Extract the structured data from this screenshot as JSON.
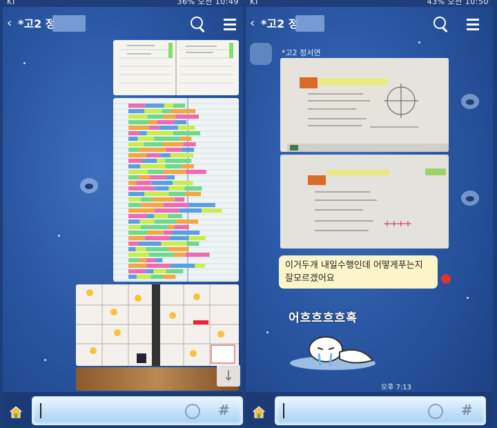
{
  "left": {
    "status": {
      "carrier": "KT",
      "info": "36% 오전 10:49"
    },
    "header": {
      "back": "‹",
      "title": "*고2 정"
    },
    "scroll_down": "↓"
  },
  "right": {
    "status": {
      "carrier": "KT",
      "info": "43% 오전 10:50"
    },
    "header": {
      "back": "‹",
      "title": "*고2 정"
    },
    "sender": "*고2 정서연",
    "message": "이거두개 내일수행인데 어떻게푸는지 잘모르겠어요",
    "sticker_text": "어흐흐흐흐흑",
    "time": "오후 7:13"
  },
  "icons": {
    "back": "back-icon",
    "search": "search-icon",
    "menu": "menu-icon",
    "emoji": "emoji-icon",
    "sharp": "sharp-icon",
    "home": "home-icon"
  }
}
